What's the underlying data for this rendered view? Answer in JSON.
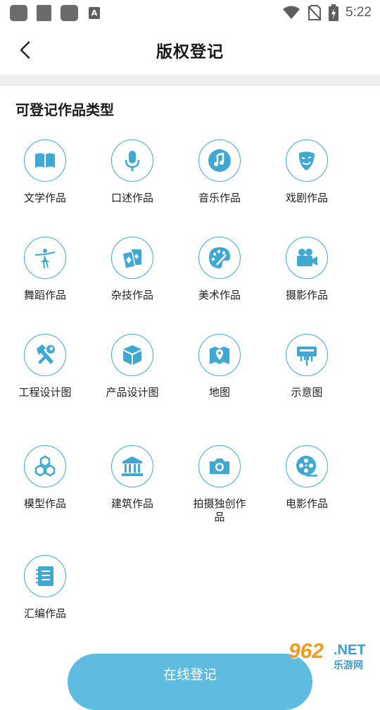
{
  "status_bar": {
    "time": "5:22",
    "app_icon_letter": "A"
  },
  "header": {
    "title": "版权登记"
  },
  "section": {
    "title": "可登记作品类型"
  },
  "work_types": [
    {
      "label": "文学作品",
      "icon": "book-icon"
    },
    {
      "label": "口述作品",
      "icon": "microphone-icon"
    },
    {
      "label": "音乐作品",
      "icon": "music-note-icon"
    },
    {
      "label": "戏剧作品",
      "icon": "theater-mask-icon"
    },
    {
      "label": "舞蹈作品",
      "icon": "dancer-icon"
    },
    {
      "label": "杂技作品",
      "icon": "cards-icon"
    },
    {
      "label": "美术作品",
      "icon": "palette-icon"
    },
    {
      "label": "摄影作品",
      "icon": "video-camera-icon"
    },
    {
      "label": "工程设计图",
      "icon": "hammer-wrench-icon"
    },
    {
      "label": "产品设计图",
      "icon": "cube-icon"
    },
    {
      "label": "地图",
      "icon": "map-icon"
    },
    {
      "label": "示意图",
      "icon": "signboard-icon"
    },
    {
      "label": "模型作品",
      "icon": "hexagons-icon"
    },
    {
      "label": "建筑作品",
      "icon": "building-icon"
    },
    {
      "label": "拍摄独创作品",
      "icon": "camera-icon"
    },
    {
      "label": "电影作品",
      "icon": "film-reel-icon"
    },
    {
      "label": "汇编作品",
      "icon": "notebook-icon"
    }
  ],
  "bottom_button": {
    "label": "在线登记"
  },
  "watermark": {
    "number": "962",
    "domain": ".NET",
    "site_name": "乐游网"
  },
  "colors": {
    "accent": "#3fa9d3",
    "button": "#5dbcdf",
    "divider": "#efeff1"
  }
}
